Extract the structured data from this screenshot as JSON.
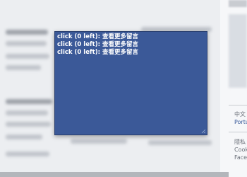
{
  "popup": {
    "lines": [
      "click (0 left): 查看更多留言",
      "click (0 left): 查看更多留言",
      "click (0 left): 查看更多留言"
    ]
  },
  "sidebar": {
    "language": "中文",
    "language_link": "Portu",
    "privacy": "隱私",
    "cookies": "Cook",
    "brand": "Face"
  },
  "colors": {
    "popup_bg": "#3b5998",
    "page_bg": "#eceef1",
    "link": "#365899"
  },
  "icons": [
    "resize-grip-icon"
  ]
}
